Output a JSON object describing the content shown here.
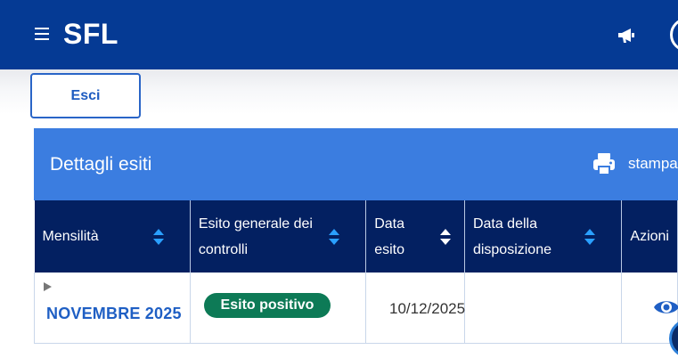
{
  "app": {
    "brand": "SFL",
    "menu_icon": "hamburger-menu-icon",
    "notification_icon": "megaphone-icon",
    "user_icon": "user-avatar-icon"
  },
  "actions": {
    "exit_label": "Esci"
  },
  "card": {
    "title": "Dettagli esiti",
    "print_label": "stampa",
    "print_icon": "printer-icon"
  },
  "table": {
    "columns": [
      {
        "label": "Mensilità"
      },
      {
        "label": "Esito generale dei controlli"
      },
      {
        "label": "Data esito"
      },
      {
        "label": "Data della disposizione"
      },
      {
        "label": "Azioni"
      }
    ],
    "rows": [
      {
        "period": "NOVEMBRE 2025",
        "result": "Esito positivo",
        "result_date": "10/12/2025",
        "disposition_date": "",
        "action_icon": "eye-view-icon"
      }
    ]
  },
  "colors": {
    "header_bg": "#053a94",
    "card_header_bg": "#3b7de0",
    "table_header_bg": "#032061",
    "link": "#1f5fc4",
    "success_badge": "#0d7a56"
  }
}
